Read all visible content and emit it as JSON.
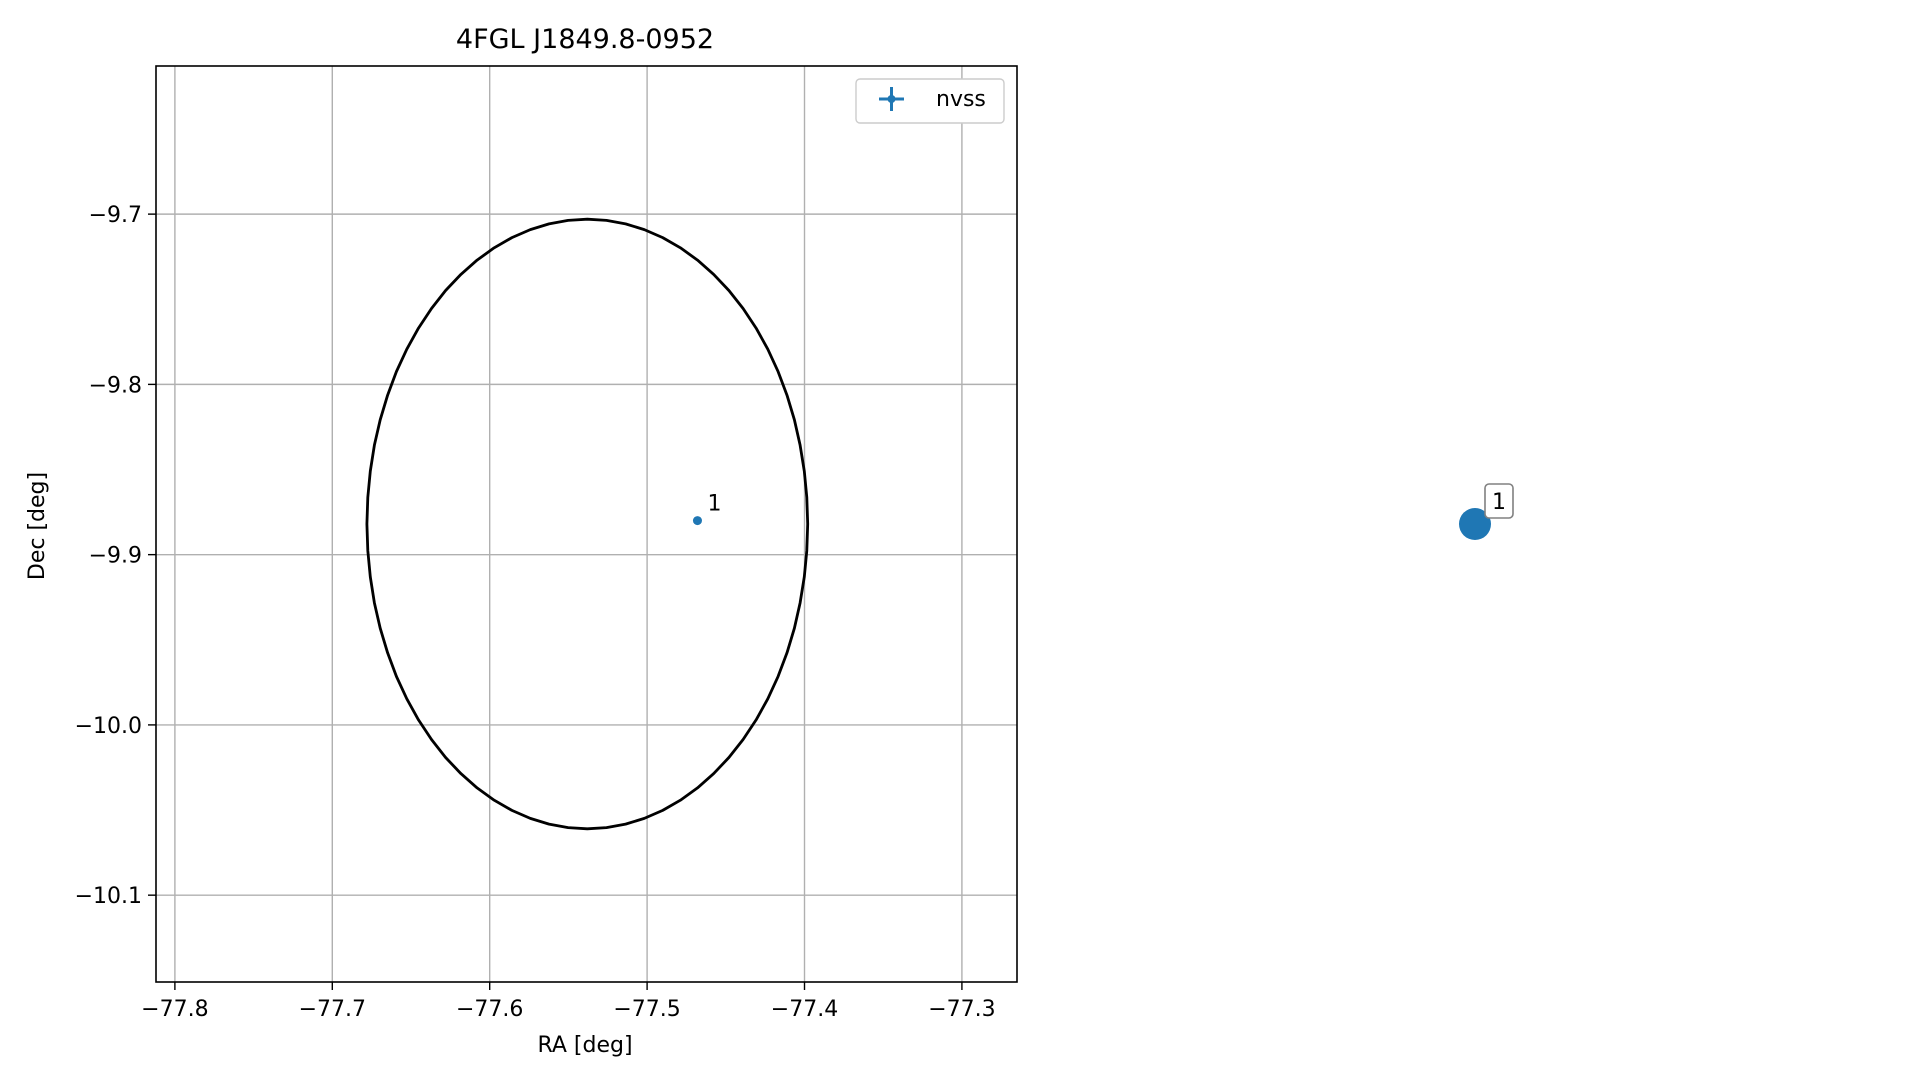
{
  "chart_data": [
    {
      "type": "scatter",
      "title": "4FGL J1849.8-0952",
      "xlabel": "RA [deg]",
      "ylabel": "Dec [deg]",
      "xlim": [
        -77.812,
        -77.265
      ],
      "ylim": [
        -10.151,
        -9.613
      ],
      "xticks": [
        -77.8,
        -77.7,
        -77.6,
        -77.5,
        -77.4,
        -77.3
      ],
      "xtick_labels": [
        "−77.8",
        "−77.7",
        "−77.6",
        "−77.5",
        "−77.4",
        "−77.3"
      ],
      "yticks": [
        -9.7,
        -9.8,
        -9.9,
        -10.0,
        -10.1
      ],
      "ytick_labels": [
        "−9.7",
        "−9.8",
        "−9.9",
        "−10.0",
        "−10.1"
      ],
      "grid": true,
      "legend": {
        "position": "top-right",
        "entries": [
          {
            "label": "nvss",
            "color": "#1f77b4",
            "marker": "errorbar-cross"
          }
        ]
      },
      "ellipse": {
        "center": [
          -77.538,
          -9.882
        ],
        "ra_semi_axis": 0.14,
        "dec_semi_axis": 0.179,
        "color": "#000000"
      },
      "series": [
        {
          "name": "nvss",
          "color": "#1f77b4",
          "points": [
            {
              "x": -77.468,
              "y": -9.88,
              "label": "1"
            }
          ]
        }
      ]
    },
    {
      "type": "scatter",
      "points": [
        {
          "label": "1",
          "color": "#1f77b4"
        }
      ]
    }
  ]
}
